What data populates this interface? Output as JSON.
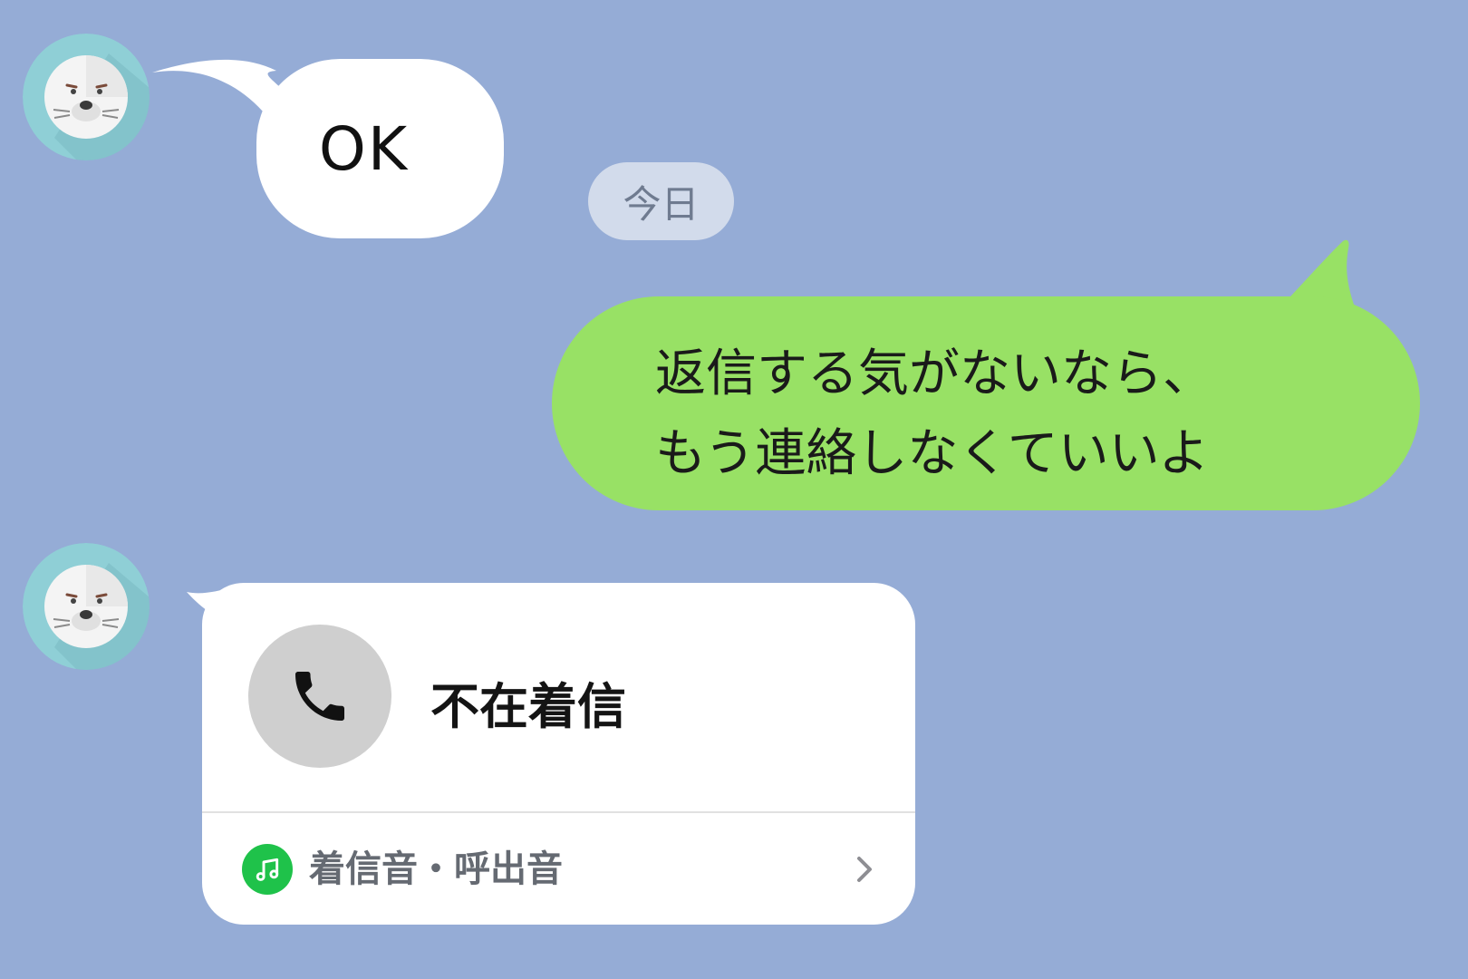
{
  "messages": {
    "incoming_first": {
      "text": "OK"
    },
    "date_separator": "今日",
    "outgoing": {
      "lines": [
        "返信する気がないなら、",
        "もう連絡しなくていいよ"
      ]
    },
    "missed_call": {
      "title": "不在着信",
      "footer_label": "着信音・呼出音"
    }
  },
  "colors": {
    "background": "#95acd6",
    "outgoing_bubble": "#98e165",
    "incoming_bubble": "#ffffff",
    "date_pill": "#d2dbeb",
    "avatar_ring": "#8fcfd6",
    "music_icon": "#1fc24a"
  },
  "icons": {
    "avatar": "seal-avatar-icon",
    "call": "phone-icon",
    "music": "music-note-icon",
    "chevron": "chevron-right-icon"
  }
}
